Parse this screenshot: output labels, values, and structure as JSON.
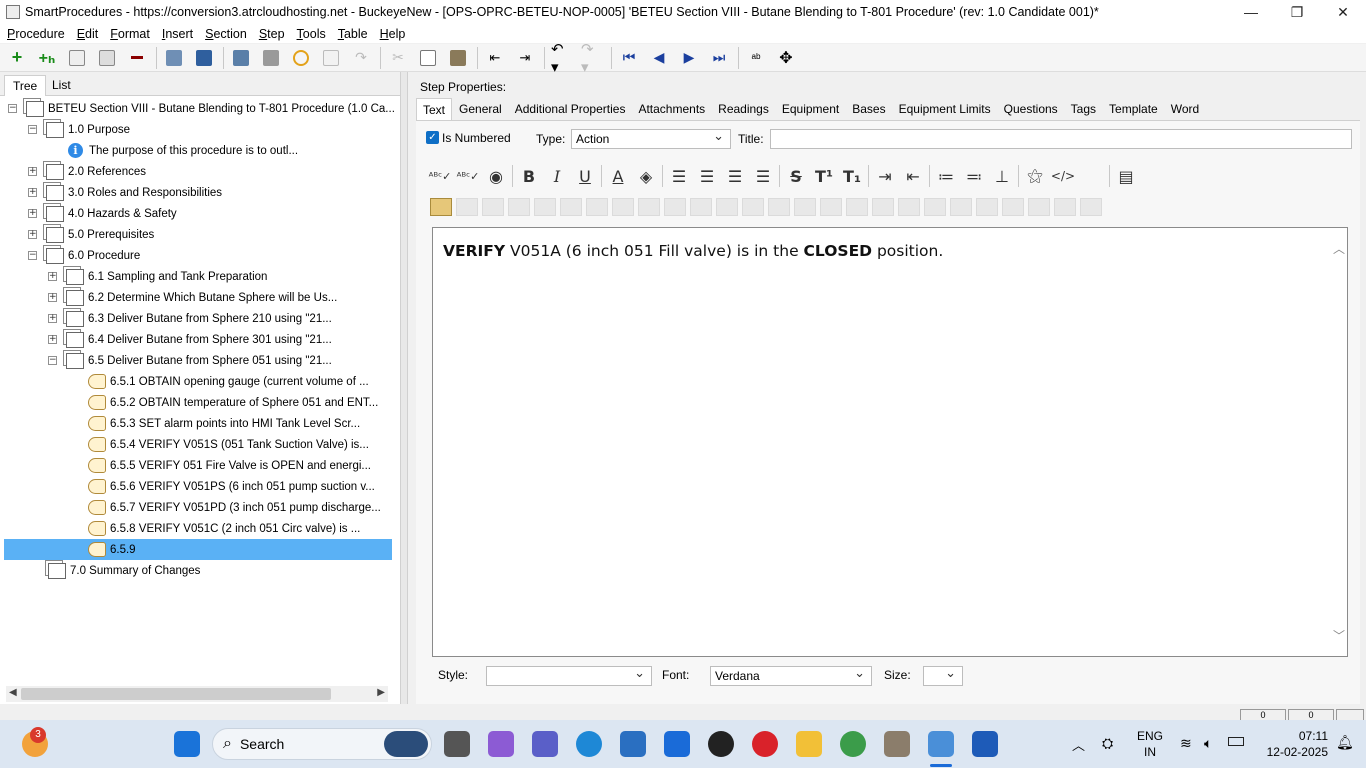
{
  "window": {
    "title": "SmartProcedures - https://conversion3.atrcloudhosting.net - BuckeyeNew - [OPS-OPRC-BETEU-NOP-0005] 'BETEU Section VIII - Butane Blending to T-801 Procedure' (rev: 1.0 Candidate 001)*"
  },
  "menu": [
    "Procedure",
    "Edit",
    "Format",
    "Insert",
    "Section",
    "Step",
    "Tools",
    "Table",
    "Help"
  ],
  "left_tabs": {
    "tree": "Tree",
    "list": "List"
  },
  "tree": {
    "root": "BETEU Section VIII - Butane Blending to T-801 Procedure (1.0 Ca...",
    "n1": "1.0 Purpose",
    "n1a": "The purpose of this procedure is to outl...",
    "n2": "2.0 References",
    "n3": "3.0 Roles and Responsibilities",
    "n4": "4.0 Hazards & Safety",
    "n5": "5.0 Prerequisites",
    "n6": "6.0 Procedure",
    "n61": "6.1 Sampling and Tank Preparation",
    "n62": "6.2 Determine Which Butane Sphere will be Us...",
    "n63": "6.3 Deliver Butane from Sphere 210 using \"21...",
    "n64": "6.4 Deliver Butane from Sphere 301 using \"21...",
    "n65": "6.5 Deliver Butane from Sphere 051 using \"21...",
    "s651": "6.5.1 OBTAIN opening gauge (current volume of ...",
    "s652": "6.5.2 OBTAIN temperature of Sphere 051 and ENT...",
    "s653": "6.5.3 SET alarm points into HMI Tank Level Scr...",
    "s654": "6.5.4 VERIFY V051S (051 Tank Suction Valve) is...",
    "s655": "6.5.5 VERIFY 051 Fire Valve is OPEN and energi...",
    "s656": "6.5.6 VERIFY V051PS (6 inch 051 pump suction v...",
    "s657": "6.5.7 VERIFY V051PD (3 inch 051 pump discharge...",
    "s658": "6.5.8 VERIFY V051C (2 inch 051 Circ valve) is ...",
    "s659": "6.5.9",
    "n7": "7.0 Summary of Changes"
  },
  "step_properties": {
    "header": "Step Properties:",
    "tabs": [
      "Text",
      "General",
      "Additional Properties",
      "Attachments",
      "Readings",
      "Equipment",
      "Bases",
      "Equipment Limits",
      "Questions",
      "Tags",
      "Template",
      "Word"
    ],
    "is_numbered_label": "Is Numbered",
    "is_numbered": true,
    "type_label": "Type:",
    "type_value": "Action",
    "title_label": "Title:",
    "title_value": ""
  },
  "editor": {
    "bold1": "VERIFY",
    "mid": " V051A (6 inch 051 Fill valve) is in the ",
    "bold2": "CLOSED",
    "end": " position."
  },
  "bottom": {
    "style_label": "Style:",
    "style_value": "",
    "font_label": "Font:",
    "font_value": "Verdana",
    "size_label": "Size:",
    "size_value": ""
  },
  "status": {
    "a": "0",
    "b": "0"
  },
  "taskbar": {
    "badge": "3",
    "search_label": "Search",
    "lang1": "ENG",
    "lang2": "IN",
    "time": "07:11",
    "date": "12-02-2025"
  },
  "colors": {
    "selection": "#5ab1f5",
    "accent": "#0f6fc6",
    "taskbar": "#dce6f2"
  }
}
